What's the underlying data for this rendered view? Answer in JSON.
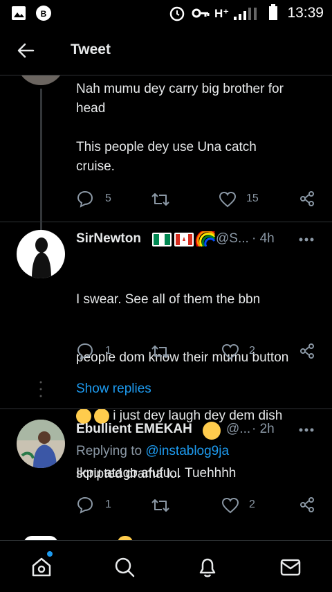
{
  "status_bar": {
    "time": "13:39",
    "network": "H⁺"
  },
  "header": {
    "title": "Tweet"
  },
  "tweet1": {
    "text": "Nah mumu dey carry big brother for\nhead\n\nThis people dey use Una catch\ncruise.",
    "reply_count": "5",
    "like_count": "15"
  },
  "tweet2": {
    "name": "SirNewton",
    "handle": "@S...",
    "time": "· 4h",
    "text_line1": "I swear. See all of them the bbn",
    "text_line2": "people dom know their mumu button",
    "text_line3_after_emoji": " i just dey laugh dey dem dish",
    "text_line4": "scripted drama lol",
    "reply_count": "1",
    "like_count": "2",
    "show_replies": "Show replies"
  },
  "tweet3": {
    "name": "Ebullient EMEKAH",
    "handle": "@...",
    "time": "· 2h",
    "replying_prefix": "Replying to",
    "replying_to": "@instablog9ja",
    "text": "Ikpu atago afufu... Tuehhhh",
    "reply_count": "1",
    "like_count": "2"
  },
  "colors": {
    "accent": "#1d9bf0",
    "muted": "#8b98a5",
    "background": "#000000"
  }
}
